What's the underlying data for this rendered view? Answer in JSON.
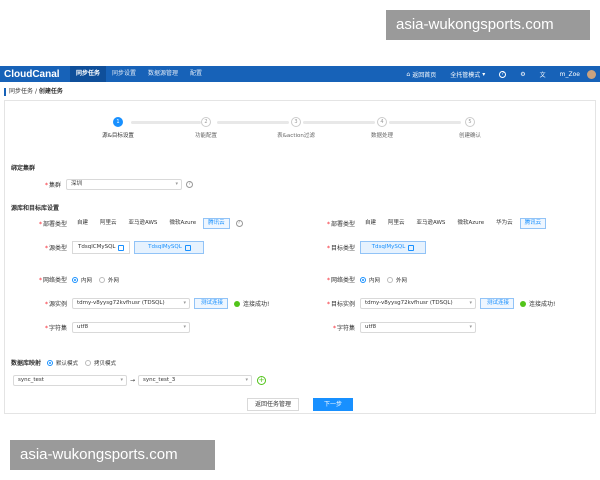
{
  "watermark": {
    "text": "asia-wukongsports.com"
  },
  "navbar": {
    "logo": "CloudCanal",
    "tabs": [
      "同步任务",
      "同步设置",
      "数据源管理",
      "配置"
    ],
    "home": "返回首页",
    "mode": "全托管模式",
    "user": "m_Zoe"
  },
  "breadcrumb": {
    "parent": "同步任务",
    "current": "创建任务"
  },
  "steps": [
    {
      "num": "1",
      "label": "源&目标设置"
    },
    {
      "num": "2",
      "label": "功能配置"
    },
    {
      "num": "3",
      "label": "表&action过滤"
    },
    {
      "num": "4",
      "label": "数据处理"
    },
    {
      "num": "5",
      "label": "创建确认"
    }
  ],
  "cluster": {
    "section": "绑定集群",
    "label": "集群",
    "value": "深圳"
  },
  "db_section": "源库和目标库设置",
  "source": {
    "deploy_label": "部署类型",
    "deploy_options": [
      "自建",
      "阿里云",
      "亚马逊AWS",
      "微软Azure",
      "腾讯云"
    ],
    "db_label": "源类型",
    "db_types": [
      "TdsqlCMySQL",
      "TdsqlMySQL"
    ],
    "network_label": "网络类型",
    "network_options": [
      "内网",
      "外网"
    ],
    "instance_label": "源实例",
    "instance_value": "tdmy-v8yysg72kvfhusr (TDSQL)",
    "test_button": "测试连接",
    "status": "连接成功!",
    "charset_label": "字符集",
    "charset_value": "utf8"
  },
  "target": {
    "deploy_label": "部署类型",
    "deploy_options": [
      "自建",
      "阿里云",
      "亚马逊AWS",
      "微软Azure",
      "华为云",
      "腾讯云"
    ],
    "db_label": "目标类型",
    "db_types": [
      "TdsqlMySQL"
    ],
    "network_label": "网络类型",
    "network_options": [
      "内网",
      "外网"
    ],
    "instance_label": "目标实例",
    "instance_value": "tdmy-v8yysg72kvfhusr (TDSQL)",
    "test_button": "测试连接",
    "status": "连接成功!",
    "charset_label": "字符集",
    "charset_value": "utf8"
  },
  "mapping": {
    "label": "数据库映射",
    "options": [
      "默认模式",
      "拷贝模式"
    ],
    "source_db": "sync_test",
    "target_db": "sync_test_3"
  },
  "buttons": {
    "back": "返回任务管理",
    "next": "下一步"
  }
}
